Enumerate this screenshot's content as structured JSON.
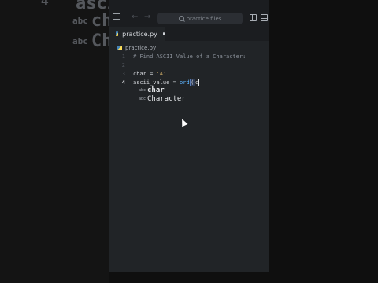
{
  "background_bleed": {
    "line_number": "4",
    "items": [
      {
        "kind": "abc",
        "word": "chai"
      },
      {
        "kind": "abc",
        "word": "Chai"
      }
    ],
    "partial_word": "ascii"
  },
  "titlebar": {
    "search_placeholder": "practice files",
    "back_icon": "arrow-left-icon",
    "forward_icon": "arrow-right-icon"
  },
  "tab": {
    "label": "practice.py",
    "modified_dot": true
  },
  "breadcrumb": {
    "label": "practice.py"
  },
  "code": {
    "line1": "# Find ASCII Value of a Character:",
    "line3_var": "char",
    "line3_eq": " = ",
    "line3_val": "'A'",
    "line4_var": "ascii_value",
    "line4_eq": " = ",
    "line4_fn": "ord",
    "line4_paren": "(",
    "line4_typed": "c",
    "line_numbers": [
      "1",
      "2",
      "3",
      "4"
    ]
  },
  "suggestions": [
    {
      "kind": "abc",
      "word": "char"
    },
    {
      "kind": "abc",
      "word": "Character"
    }
  ],
  "colors": {
    "editor_bg": "#212427",
    "chrome_bg": "#1b1d20",
    "function": "#5cb3ff",
    "string": "#d6b26a"
  }
}
